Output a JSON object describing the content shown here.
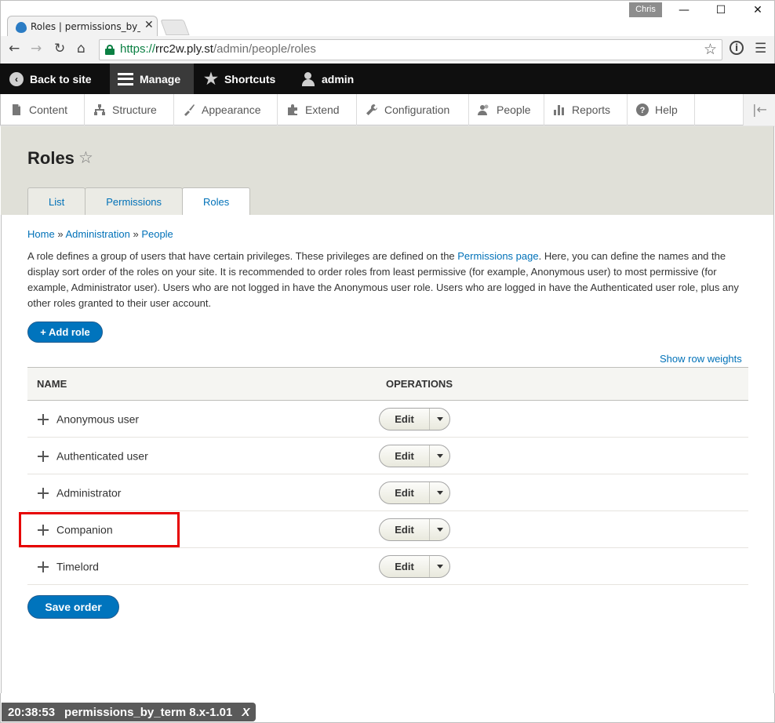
{
  "browser": {
    "tab_title": "Roles | permissions_by_ter",
    "profile_name": "Chris",
    "url_scheme": "https://",
    "url_host": "rrc2w.ply.st",
    "url_path": "/admin/people/roles",
    "window_controls": {
      "minimize": "—",
      "maximize": "☐",
      "close": "✕"
    }
  },
  "admin_toolbar": {
    "back_to_site": "Back to site",
    "manage": "Manage",
    "shortcuts": "Shortcuts",
    "user": "admin"
  },
  "tray": {
    "items": [
      {
        "label": "Content",
        "icon": "document-icon"
      },
      {
        "label": "Structure",
        "icon": "sitemap-icon"
      },
      {
        "label": "Appearance",
        "icon": "brush-icon"
      },
      {
        "label": "Extend",
        "icon": "puzzle-icon"
      },
      {
        "label": "Configuration",
        "icon": "wrench-icon"
      },
      {
        "label": "People",
        "icon": "people-icon"
      },
      {
        "label": "Reports",
        "icon": "bar-chart-icon"
      },
      {
        "label": "Help",
        "icon": "help-icon"
      }
    ]
  },
  "page": {
    "title": "Roles",
    "tabs": [
      {
        "label": "List",
        "active": false
      },
      {
        "label": "Permissions",
        "active": false
      },
      {
        "label": "Roles",
        "active": true
      }
    ],
    "breadcrumb": [
      {
        "label": "Home"
      },
      {
        "label": "Administration"
      },
      {
        "label": "People"
      }
    ],
    "breadcrumb_separator": "»",
    "help_text_before": "A role defines a group of users that have certain privileges. These privileges are defined on the ",
    "help_link": "Permissions page",
    "help_text_after": ". Here, you can define the names and the display sort order of the roles on your site. It is recommended to order roles from least permissive (for example, Anonymous user) to most permissive (for example, Administrator user). Users who are not logged in have the Anonymous user role. Users who are logged in have the Authenticated user role, plus any other roles granted to their user account.",
    "add_role_label": "+ Add role",
    "show_row_weights": "Show row weights",
    "save_order": "Save order"
  },
  "table": {
    "headers": [
      "NAME",
      "OPERATIONS"
    ],
    "rows": [
      {
        "name": "Anonymous user",
        "operation": "Edit"
      },
      {
        "name": "Authenticated user",
        "operation": "Edit"
      },
      {
        "name": "Administrator",
        "operation": "Edit"
      },
      {
        "name": "Companion",
        "operation": "Edit",
        "highlighted": true
      },
      {
        "name": "Timelord",
        "operation": "Edit"
      }
    ]
  },
  "overlay": {
    "time": "20:38:53",
    "label": "permissions_by_term 8.x-1.01",
    "close": "X"
  },
  "colors": {
    "link": "#0071b8",
    "primary_button": "#0074bd",
    "admin_bar": "#0f0f0f",
    "header_bg": "#e0e0d8",
    "highlight": "#e60000"
  }
}
